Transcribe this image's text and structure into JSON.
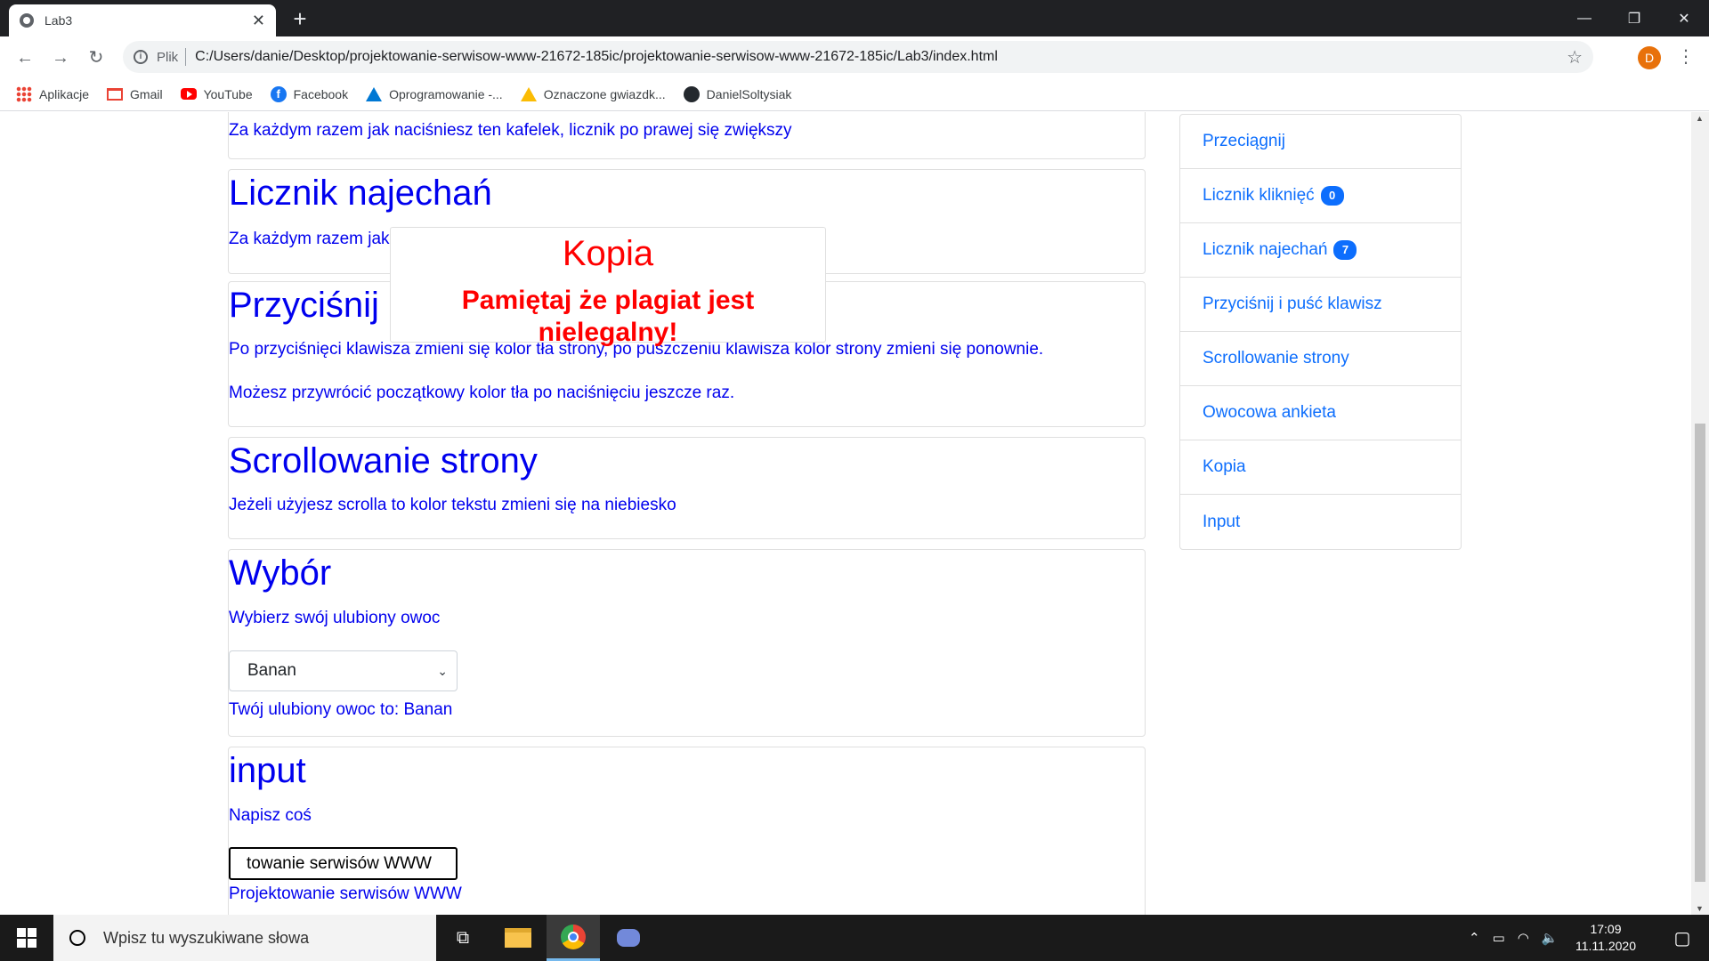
{
  "browser": {
    "tab_title": "Lab3",
    "address_prefix": "Plik",
    "url": "C:/Users/danie/Desktop/projektowanie-serwisow-www-21672-185ic/projektowanie-serwisow-www-21672-185ic/Lab3/index.html",
    "profile_initial": "D"
  },
  "bookmarks": [
    {
      "label": "Aplikacje",
      "icon": "apps-grid-icon"
    },
    {
      "label": "Gmail",
      "icon": "gmail-icon"
    },
    {
      "label": "YouTube",
      "icon": "youtube-icon"
    },
    {
      "label": "Facebook",
      "icon": "facebook-icon"
    },
    {
      "label": "Oprogramowanie -...",
      "icon": "azure-icon"
    },
    {
      "label": "Oznaczone gwiazdk...",
      "icon": "google-drive-icon"
    },
    {
      "label": "DanielSoltysiak",
      "icon": "github-icon"
    }
  ],
  "cards": {
    "click_counter": {
      "text": "Za każdym razem jak naciśniesz ten kafelek, licznik po prawej się zwiększy"
    },
    "hover_counter": {
      "title": "Licznik najechań",
      "text": "Za każdym razem jak"
    },
    "keypress": {
      "title": "Przyciśnij",
      "text1": "Po przyciśnięci klawisza zmieni się kolor tła strony, po puszczeniu klawisza kolor strony zmieni się ponownie.",
      "text2": "Możesz przywrócić początkowy kolor tła po naciśnięciu jeszcze raz."
    },
    "scroll": {
      "title": "Scrollowanie strony",
      "text": "Jeżeli użyjesz scrolla to kolor tekstu zmieni się na niebiesko"
    },
    "choice": {
      "title": "Wybór",
      "prompt": "Wybierz swój ulubiony owoc",
      "selected": "Banan",
      "result": "Twój ulubiony owoc to: Banan"
    },
    "input": {
      "title": "input",
      "prompt": "Napisz coś",
      "value": "towanie serwisów WWW",
      "echo": "Projektowanie serwisów WWW"
    }
  },
  "modal": {
    "title": "Kopia",
    "message": "Pamiętaj że plagiat jest nielegalny!"
  },
  "sidebar": [
    {
      "label": "Przeciągnij",
      "badge": null
    },
    {
      "label": "Licznik kliknięć",
      "badge": "0"
    },
    {
      "label": "Licznik najechań",
      "badge": "7"
    },
    {
      "label": "Przyciśnij i puść klawisz",
      "badge": null
    },
    {
      "label": "Scrollowanie strony",
      "badge": null
    },
    {
      "label": "Owocowa ankieta",
      "badge": null
    },
    {
      "label": "Kopia",
      "badge": null
    },
    {
      "label": "Input",
      "badge": null
    }
  ],
  "taskbar": {
    "search_placeholder": "Wpisz tu wyszukiwane słowa",
    "time": "17:09",
    "date": "11.11.2020"
  },
  "colors": {
    "text_blue": "#0000ee",
    "link_blue": "#0d6efd",
    "modal_red": "#ff0000"
  }
}
